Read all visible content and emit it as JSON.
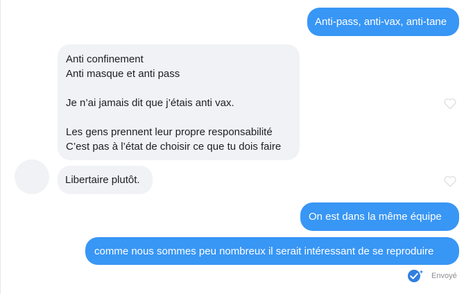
{
  "conversation": {
    "messages": [
      {
        "direction": "outgoing",
        "lines": [
          "Anti-pass, anti-vax, anti-tane"
        ]
      },
      {
        "direction": "incoming",
        "lines": [
          "Anti confinement",
          "Anti masque et anti pass",
          "",
          "Je n’ai jamais dit que j’étais anti vax.",
          "",
          "Les gens prennent leur propre responsabilité",
          "C’est pas à l’état de choisir ce que tu dois faire"
        ]
      },
      {
        "direction": "incoming",
        "lines": [
          "Libertaire plutôt."
        ]
      },
      {
        "direction": "outgoing",
        "lines": [
          "On est dans la même équipe"
        ]
      },
      {
        "direction": "outgoing",
        "lines": [
          "comme nous sommes peu nombreux il serait intéressant de se reproduire"
        ]
      }
    ],
    "status": {
      "label": "Envoyé",
      "icon": "sent-check-icon"
    },
    "icons": {
      "reaction": "heart-outline-icon",
      "avatar": "avatar-placeholder"
    },
    "colors": {
      "outgoing_bubble": "#3896f5",
      "incoming_bubble": "#f1f2f6",
      "status_check": "#2f7fe0"
    }
  }
}
